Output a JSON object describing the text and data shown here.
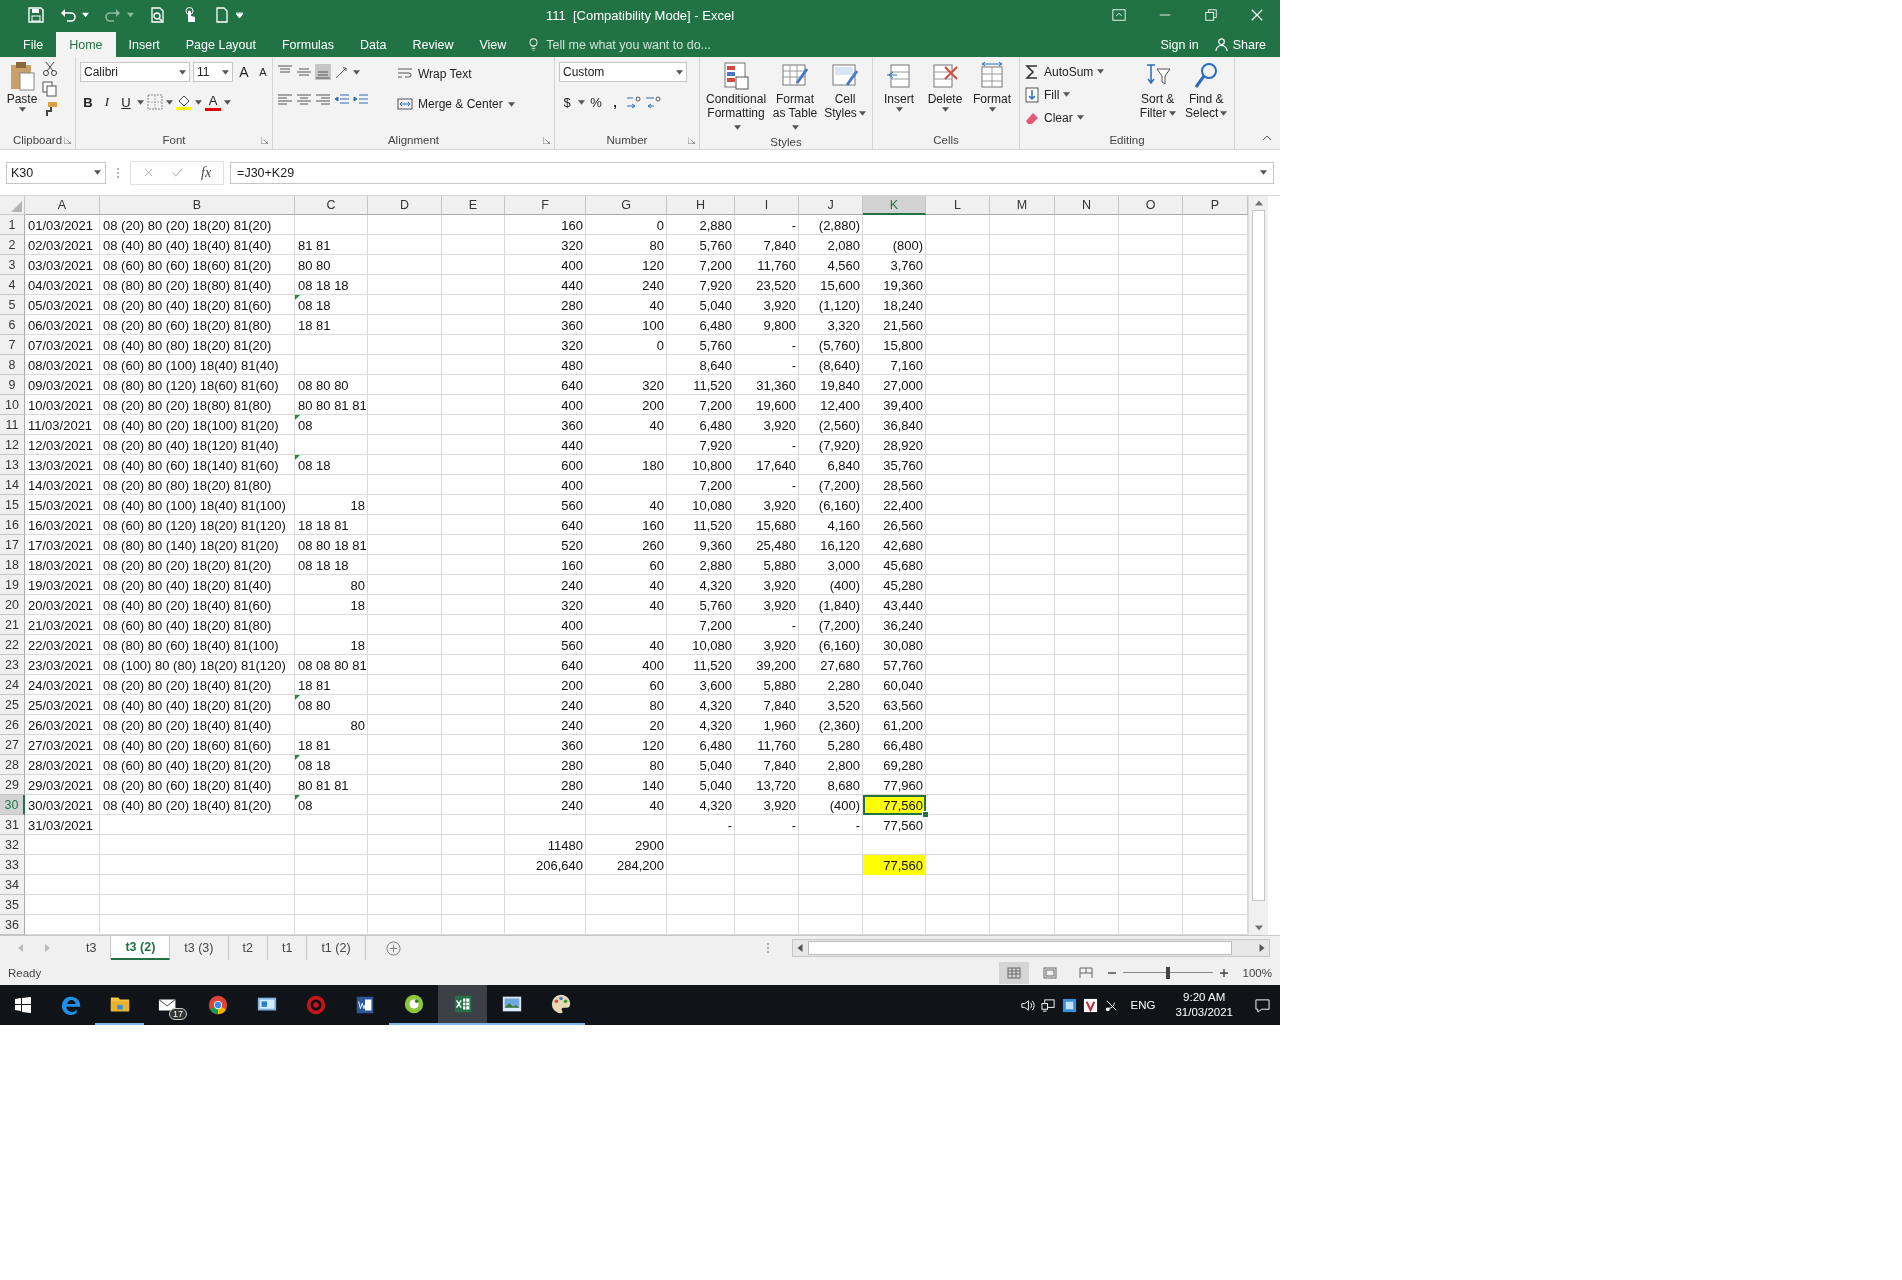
{
  "window": {
    "title": "111  [Compatibility Mode] - Excel"
  },
  "menu_tabs": [
    {
      "label": "File",
      "selected": false
    },
    {
      "label": "Home",
      "selected": true
    },
    {
      "label": "Insert",
      "selected": false
    },
    {
      "label": "Page Layout",
      "selected": false
    },
    {
      "label": "Formulas",
      "selected": false
    },
    {
      "label": "Data",
      "selected": false
    },
    {
      "label": "Review",
      "selected": false
    },
    {
      "label": "View",
      "selected": false
    }
  ],
  "tell_me": {
    "placeholder": "Tell me what you want to do..."
  },
  "account": {
    "sign_in": "Sign in",
    "share": "Share"
  },
  "ribbon": {
    "clipboard": {
      "paste": "Paste",
      "label": "Clipboard"
    },
    "font": {
      "name": "Calibri",
      "size": "11",
      "grow": "A",
      "shrink": "A",
      "bold": "B",
      "italic": "I",
      "underline": "U",
      "font_color": "A",
      "label": "Font"
    },
    "alignment": {
      "wrap": "Wrap Text",
      "merge": "Merge & Center",
      "label": "Alignment"
    },
    "number": {
      "format": "Custom",
      "currency": "$",
      "percent": "%",
      "comma": ",",
      "label": "Number"
    },
    "styles": {
      "conditional": "Conditional Formatting",
      "table": "Format as Table",
      "cell": "Cell Styles",
      "label": "Styles"
    },
    "cells": {
      "insert": "Insert",
      "delete": "Delete",
      "format": "Format",
      "label": "Cells"
    },
    "editing": {
      "autosum": "AutoSum",
      "fill": "Fill",
      "clear": "Clear",
      "sort": "Sort & Filter",
      "find": "Find & Select",
      "label": "Editing"
    }
  },
  "formula_bar": {
    "name_box": "K30",
    "fx": "fx",
    "formula": "=J30+K29"
  },
  "sheet": {
    "columns": [
      {
        "label": "A",
        "kind": "text",
        "selected": false
      },
      {
        "label": "B",
        "kind": "text",
        "selected": false
      },
      {
        "label": "C",
        "kind": "text",
        "selected": false
      },
      {
        "label": "D",
        "selected": false
      },
      {
        "label": "E",
        "selected": false
      },
      {
        "label": "F",
        "kind": "number",
        "selected": false
      },
      {
        "label": "G",
        "kind": "number",
        "selected": false
      },
      {
        "label": "H",
        "kind": "number",
        "selected": false
      },
      {
        "label": "I",
        "kind": "number",
        "selected": false
      },
      {
        "label": "J",
        "kind": "number",
        "selected": false
      },
      {
        "label": "K",
        "kind": "number",
        "selected": true
      },
      {
        "label": "L",
        "selected": false
      },
      {
        "label": "M",
        "selected": false
      },
      {
        "label": "N",
        "selected": false
      },
      {
        "label": "O",
        "selected": false
      },
      {
        "label": "P",
        "selected": false
      }
    ],
    "rows": [
      {
        "num": "1",
        "selected": false,
        "cells": [
          "01/03/2021",
          "08 (20) 80 (20) 18(20) 81(20)",
          null,
          null,
          null,
          "160",
          "0",
          "2,880",
          "-",
          "(2,880)",
          null
        ]
      },
      {
        "num": "2",
        "selected": false,
        "cells": [
          "02/03/2021",
          "08 (40) 80 (40) 18(40) 81(40)",
          "81 81",
          null,
          null,
          "320",
          "80",
          "5,760",
          "7,840",
          "2,080",
          "(800)"
        ]
      },
      {
        "num": "3",
        "selected": false,
        "cells": [
          "03/03/2021",
          "08 (60) 80 (60) 18(60) 81(20)",
          "80 80",
          null,
          null,
          "400",
          "120",
          "7,200",
          "11,760",
          "4,560",
          "3,760"
        ]
      },
      {
        "num": "4",
        "selected": false,
        "cells": [
          "04/03/2021",
          "08 (80) 80 (20) 18(80) 81(40)",
          "08 18 18",
          null,
          null,
          "440",
          "240",
          "7,920",
          "23,520",
          "15,600",
          "19,360"
        ]
      },
      {
        "num": "5",
        "selected": false,
        "cells": [
          "05/03/2021",
          "08 (20) 80 (40) 18(20) 81(60)",
          {
            "text": "08 18",
            "flag": true
          },
          null,
          null,
          "280",
          "40",
          "5,040",
          "3,920",
          "(1,120)",
          "18,240"
        ]
      },
      {
        "num": "6",
        "selected": false,
        "cells": [
          "06/03/2021",
          "08 (20) 80 (60) 18(20) 81(80)",
          "18 81",
          null,
          null,
          "360",
          "100",
          "6,480",
          "9,800",
          "3,320",
          "21,560"
        ]
      },
      {
        "num": "7",
        "selected": false,
        "cells": [
          "07/03/2021",
          "08 (40) 80 (80) 18(20) 81(20)",
          null,
          null,
          null,
          "320",
          "0",
          "5,760",
          "-",
          "(5,760)",
          "15,800"
        ]
      },
      {
        "num": "8",
        "selected": false,
        "cells": [
          "08/03/2021",
          "08 (60) 80 (100) 18(40) 81(40)",
          null,
          null,
          null,
          "480",
          null,
          "8,640",
          "-",
          "(8,640)",
          "7,160"
        ]
      },
      {
        "num": "9",
        "selected": false,
        "cells": [
          "09/03/2021",
          "08 (80) 80 (120) 18(60) 81(60)",
          "08 80 80",
          null,
          null,
          "640",
          "320",
          "11,520",
          "31,360",
          "19,840",
          "27,000"
        ]
      },
      {
        "num": "10",
        "selected": false,
        "cells": [
          "10/03/2021",
          "08 (20) 80 (20) 18(80) 81(80)",
          "80 80 81 81",
          null,
          null,
          "400",
          "200",
          "7,200",
          "19,600",
          "12,400",
          "39,400"
        ]
      },
      {
        "num": "11",
        "selected": false,
        "cells": [
          "11/03/2021",
          "08 (40) 80 (20) 18(100) 81(20)",
          {
            "text": "08",
            "flag": true
          },
          null,
          null,
          "360",
          "40",
          "6,480",
          "3,920",
          "(2,560)",
          "36,840"
        ]
      },
      {
        "num": "12",
        "selected": false,
        "cells": [
          "12/03/2021",
          "08 (20) 80 (40) 18(120) 81(40)",
          null,
          null,
          null,
          "440",
          null,
          "7,920",
          "-",
          "(7,920)",
          "28,920"
        ]
      },
      {
        "num": "13",
        "selected": false,
        "cells": [
          "13/03/2021",
          "08 (40) 80 (60) 18(140) 81(60)",
          {
            "text": "08 18",
            "flag": true
          },
          null,
          null,
          "600",
          "180",
          "10,800",
          "17,640",
          "6,840",
          "35,760"
        ]
      },
      {
        "num": "14",
        "selected": false,
        "cells": [
          "14/03/2021",
          "08 (20) 80 (80) 18(20) 81(80)",
          null,
          null,
          null,
          "400",
          null,
          "7,200",
          "-",
          "(7,200)",
          "28,560"
        ]
      },
      {
        "num": "15",
        "selected": false,
        "cells": [
          "15/03/2021",
          "08 (40) 80 (100) 18(40) 81(100)",
          {
            "text": "18",
            "kind": "number"
          },
          null,
          null,
          "560",
          "40",
          "10,080",
          "3,920",
          "(6,160)",
          "22,400"
        ]
      },
      {
        "num": "16",
        "selected": false,
        "cells": [
          "16/03/2021",
          "08 (60) 80 (120) 18(20) 81(120)",
          "18 18 81",
          null,
          null,
          "640",
          "160",
          "11,520",
          "15,680",
          "4,160",
          "26,560"
        ]
      },
      {
        "num": "17",
        "selected": false,
        "cells": [
          "17/03/2021",
          "08 (80) 80 (140) 18(20) 81(20)",
          "08 80 18 81",
          null,
          null,
          "520",
          "260",
          "9,360",
          "25,480",
          "16,120",
          "42,680"
        ]
      },
      {
        "num": "18",
        "selected": false,
        "cells": [
          "18/03/2021",
          "08 (20) 80 (20) 18(20) 81(20)",
          "08 18 18",
          null,
          null,
          "160",
          "60",
          "2,880",
          "5,880",
          "3,000",
          "45,680"
        ]
      },
      {
        "num": "19",
        "selected": false,
        "cells": [
          "19/03/2021",
          "08 (20) 80 (40) 18(20) 81(40)",
          {
            "text": "80",
            "kind": "number"
          },
          null,
          null,
          "240",
          "40",
          "4,320",
          "3,920",
          "(400)",
          "45,280"
        ]
      },
      {
        "num": "20",
        "selected": false,
        "cells": [
          "20/03/2021",
          "08 (40) 80 (20) 18(40) 81(60)",
          {
            "text": "18",
            "kind": "number"
          },
          null,
          null,
          "320",
          "40",
          "5,760",
          "3,920",
          "(1,840)",
          "43,440"
        ]
      },
      {
        "num": "21",
        "selected": false,
        "cells": [
          "21/03/2021",
          "08 (60) 80 (40) 18(20) 81(80)",
          null,
          null,
          null,
          "400",
          null,
          "7,200",
          "-",
          "(7,200)",
          "36,240"
        ]
      },
      {
        "num": "22",
        "selected": false,
        "cells": [
          "22/03/2021",
          "08 (80) 80 (60) 18(40) 81(100)",
          {
            "text": "18",
            "kind": "number"
          },
          null,
          null,
          "560",
          "40",
          "10,080",
          "3,920",
          "(6,160)",
          "30,080"
        ]
      },
      {
        "num": "23",
        "selected": false,
        "cells": [
          "23/03/2021",
          "08 (100) 80 (80) 18(20) 81(120)",
          "08 08 80 81",
          null,
          null,
          "640",
          "400",
          "11,520",
          "39,200",
          "27,680",
          "57,760"
        ]
      },
      {
        "num": "24",
        "selected": false,
        "cells": [
          "24/03/2021",
          "08 (20) 80 (20) 18(40) 81(20)",
          "18 81",
          null,
          null,
          "200",
          "60",
          "3,600",
          "5,880",
          "2,280",
          "60,040"
        ]
      },
      {
        "num": "25",
        "selected": false,
        "cells": [
          "25/03/2021",
          "08 (40) 80 (40) 18(20) 81(20)",
          {
            "text": "08 80",
            "flag": true
          },
          null,
          null,
          "240",
          "80",
          "4,320",
          "7,840",
          "3,520",
          "63,560"
        ]
      },
      {
        "num": "26",
        "selected": false,
        "cells": [
          "26/03/2021",
          "08 (20) 80 (20) 18(40) 81(40)",
          {
            "text": "80",
            "kind": "number"
          },
          null,
          null,
          "240",
          "20",
          "4,320",
          "1,960",
          "(2,360)",
          "61,200"
        ]
      },
      {
        "num": "27",
        "selected": false,
        "cells": [
          "27/03/2021",
          "08 (40) 80 (20) 18(60) 81(60)",
          "18 81",
          null,
          null,
          "360",
          "120",
          "6,480",
          "11,760",
          "5,280",
          "66,480"
        ]
      },
      {
        "num": "28",
        "selected": false,
        "cells": [
          "28/03/2021",
          "08 (60) 80 (40) 18(20) 81(20)",
          {
            "text": "08 18",
            "flag": true
          },
          null,
          null,
          "280",
          "80",
          "5,040",
          "7,840",
          "2,800",
          "69,280"
        ]
      },
      {
        "num": "29",
        "selected": false,
        "cells": [
          "29/03/2021",
          "08 (20) 80 (60) 18(20) 81(40)",
          "80 81 81",
          null,
          null,
          "280",
          "140",
          "5,040",
          "13,720",
          "8,680",
          "77,960"
        ]
      },
      {
        "num": "30",
        "selected": true,
        "cells": [
          "30/03/2021",
          "08 (40) 80 (20) 18(40) 81(20)",
          {
            "text": "08",
            "flag": true
          },
          null,
          null,
          "240",
          "40",
          "4,320",
          "3,920",
          "(400)",
          {
            "text": "77,560",
            "color": "#ffff00"
          }
        ]
      },
      {
        "num": "31",
        "selected": false,
        "cells": [
          "31/03/2021",
          null,
          null,
          null,
          null,
          null,
          null,
          "-",
          "-",
          "-",
          "77,560"
        ]
      },
      {
        "num": "32",
        "selected": false,
        "cells": [
          null,
          null,
          null,
          null,
          null,
          "11480",
          "2900"
        ]
      },
      {
        "num": "33",
        "selected": false,
        "cells": [
          null,
          null,
          null,
          null,
          null,
          "206,640",
          "284,200",
          null,
          null,
          null,
          {
            "text": "77,560",
            "color": "#ffff00"
          }
        ]
      },
      {
        "num": "34",
        "selected": false
      },
      {
        "num": "35",
        "selected": false
      },
      {
        "num": "36",
        "selected": false
      }
    ]
  },
  "sheet_tabs": [
    {
      "label": "t3",
      "selected": false
    },
    {
      "label": "t3 (2)",
      "selected": true
    },
    {
      "label": "t3 (3)",
      "selected": false
    },
    {
      "label": "t2",
      "selected": false
    },
    {
      "label": "t1",
      "selected": false
    },
    {
      "label": "t1 (2)",
      "selected": false
    }
  ],
  "status": {
    "text": "Ready",
    "views": [
      {
        "kind": "normal",
        "selected": true
      },
      {
        "kind": "layout",
        "selected": false
      },
      {
        "kind": "pagebreak",
        "selected": false
      }
    ],
    "zoom": {
      "level": 0.5,
      "reading": "100%"
    }
  },
  "taskbar": {
    "apps": [
      {
        "kind": "edge",
        "running": false,
        "selected": false
      },
      {
        "kind": "folder",
        "running": true,
        "selected": false
      },
      {
        "kind": "mail",
        "running": false,
        "selected": false,
        "badge": "17"
      },
      {
        "kind": "chrome",
        "running": false,
        "selected": false
      },
      {
        "kind": "monitor",
        "running": false,
        "selected": false
      },
      {
        "kind": "target",
        "running": false,
        "selected": false
      },
      {
        "kind": "word",
        "running": false,
        "selected": false
      },
      {
        "kind": "ring",
        "running": true,
        "selected": false
      },
      {
        "kind": "excel",
        "running": true,
        "selected": true
      },
      {
        "kind": "picture",
        "running": true,
        "selected": false
      },
      {
        "kind": "palette",
        "running": true,
        "selected": false
      }
    ],
    "lang": "ENG",
    "time": "9:20 AM",
    "date": "31/03/2021"
  }
}
